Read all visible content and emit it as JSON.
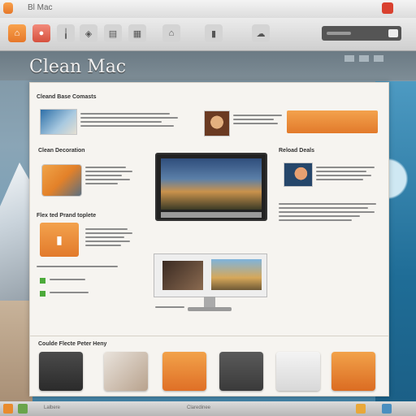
{
  "window": {
    "title": "Clean Mac",
    "menu_title": "Bl Mac"
  },
  "toolbar": {
    "items": [
      {
        "label": "",
        "icon": "home-icon",
        "style": "orange"
      },
      {
        "label": "",
        "icon": "record-icon",
        "style": "red"
      },
      {
        "label": "",
        "icon": "pin-icon"
      },
      {
        "label": "",
        "icon": "tag-icon"
      },
      {
        "label": "",
        "icon": "doc-icon"
      },
      {
        "label": "",
        "icon": "grid-icon"
      },
      {
        "label": "",
        "icon": "house-icon"
      },
      {
        "label": "",
        "icon": "lock-icon"
      },
      {
        "label": "",
        "icon": "cloud-icon"
      }
    ],
    "search_placeholder": ""
  },
  "page": {
    "brand": "Clean Mac",
    "sections": {
      "top": "Cleand Base Comasts",
      "mid_left": "Clean Decoration",
      "mid_right": "Reload Deals",
      "lower_left": "Flex ted Prand toplete",
      "bottom": "Coulde Flecte Peter Heny"
    },
    "bottom_label": "Claredinee"
  },
  "dock": {
    "left_label": "Lalbere"
  },
  "colors": {
    "accent_orange": "#e27a2b",
    "accent_green": "#4caa3a"
  }
}
